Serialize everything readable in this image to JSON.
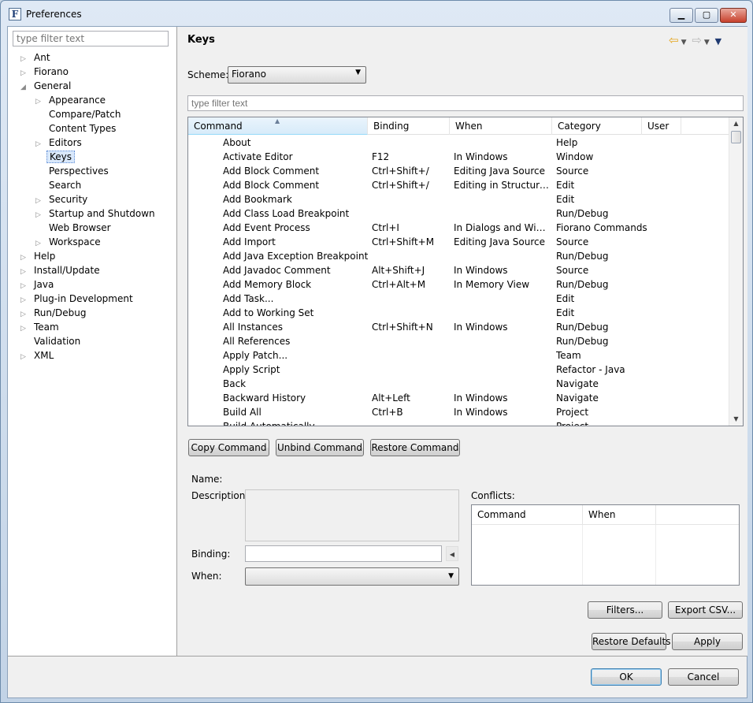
{
  "window": {
    "title": "Preferences",
    "icon_letter": "F",
    "controls": [
      "minimize-icon",
      "maximize-icon",
      "close-icon"
    ]
  },
  "left": {
    "filter_placeholder": "type filter text",
    "tree": [
      {
        "label": "Ant",
        "expander": "▷",
        "depth": 0
      },
      {
        "label": "Fiorano",
        "expander": "▷",
        "depth": 0
      },
      {
        "label": "General",
        "expander": "◢",
        "depth": 0
      },
      {
        "label": "Appearance",
        "expander": "▷",
        "depth": 1
      },
      {
        "label": "Compare/Patch",
        "expander": "",
        "depth": 1
      },
      {
        "label": "Content Types",
        "expander": "",
        "depth": 1
      },
      {
        "label": "Editors",
        "expander": "▷",
        "depth": 1
      },
      {
        "label": "Keys",
        "expander": "",
        "depth": 1,
        "selected": true
      },
      {
        "label": "Perspectives",
        "expander": "",
        "depth": 1
      },
      {
        "label": "Search",
        "expander": "",
        "depth": 1
      },
      {
        "label": "Security",
        "expander": "▷",
        "depth": 1
      },
      {
        "label": "Startup and Shutdown",
        "expander": "▷",
        "depth": 1
      },
      {
        "label": "Web Browser",
        "expander": "",
        "depth": 1
      },
      {
        "label": "Workspace",
        "expander": "▷",
        "depth": 1
      },
      {
        "label": "Help",
        "expander": "▷",
        "depth": 0
      },
      {
        "label": "Install/Update",
        "expander": "▷",
        "depth": 0
      },
      {
        "label": "Java",
        "expander": "▷",
        "depth": 0
      },
      {
        "label": "Plug-in Development",
        "expander": "▷",
        "depth": 0
      },
      {
        "label": "Run/Debug",
        "expander": "▷",
        "depth": 0
      },
      {
        "label": "Team",
        "expander": "▷",
        "depth": 0
      },
      {
        "label": "Validation",
        "expander": "",
        "depth": 0
      },
      {
        "label": "XML",
        "expander": "▷",
        "depth": 0
      }
    ]
  },
  "page": {
    "title": "Keys",
    "scheme_label": "Scheme:",
    "scheme_value": "Fiorano",
    "filter_placeholder": "type filter text",
    "table": {
      "columns": [
        "Command",
        "Binding",
        "When",
        "Category",
        "User"
      ],
      "sort_glyph": "▲",
      "rows": [
        [
          "About",
          "",
          "",
          "Help"
        ],
        [
          "Activate Editor",
          "F12",
          "In Windows",
          "Window"
        ],
        [
          "Add Block Comment",
          "Ctrl+Shift+/",
          "Editing Java Source",
          "Source"
        ],
        [
          "Add Block Comment",
          "Ctrl+Shift+/",
          "Editing in Structured ...",
          "Edit"
        ],
        [
          "Add Bookmark",
          "",
          "",
          "Edit"
        ],
        [
          "Add Class Load Breakpoint",
          "",
          "",
          "Run/Debug"
        ],
        [
          "Add Event Process",
          "Ctrl+I",
          "In Dialogs and Windo...",
          "Fiorano Commands"
        ],
        [
          "Add Import",
          "Ctrl+Shift+M",
          "Editing Java Source",
          "Source"
        ],
        [
          "Add Java Exception Breakpoint",
          "",
          "",
          "Run/Debug"
        ],
        [
          "Add Javadoc Comment",
          "Alt+Shift+J",
          "In Windows",
          "Source"
        ],
        [
          "Add Memory Block",
          "Ctrl+Alt+M",
          "In Memory View",
          "Run/Debug"
        ],
        [
          "Add Task...",
          "",
          "",
          "Edit"
        ],
        [
          "Add to Working Set",
          "",
          "",
          "Edit"
        ],
        [
          "All Instances",
          "Ctrl+Shift+N",
          "In Windows",
          "Run/Debug"
        ],
        [
          "All References",
          "",
          "",
          "Run/Debug"
        ],
        [
          "Apply Patch...",
          "",
          "",
          "Team"
        ],
        [
          "Apply Script",
          "",
          "",
          "Refactor - Java"
        ],
        [
          "Back",
          "",
          "",
          "Navigate"
        ],
        [
          "Backward History",
          "Alt+Left",
          "In Windows",
          "Navigate"
        ],
        [
          "Build All",
          "Ctrl+B",
          "In Windows",
          "Project"
        ],
        [
          "Build Automatically",
          "",
          "",
          "Project"
        ]
      ]
    },
    "buttons": {
      "copy_command": "Copy Command",
      "unbind_command": "Unbind Command",
      "restore_command": "Restore Command",
      "filters": "Filters...",
      "export_csv": "Export CSV...",
      "restore_defaults": "Restore Defaults",
      "apply": "Apply"
    },
    "details": {
      "name_label": "Name:",
      "description_label": "Description:",
      "binding_label": "Binding:",
      "when_label": "When:",
      "conflicts_label": "Conflicts:",
      "conflicts_columns": [
        "Command",
        "When"
      ]
    }
  },
  "footer": {
    "ok": "OK",
    "cancel": "Cancel"
  }
}
